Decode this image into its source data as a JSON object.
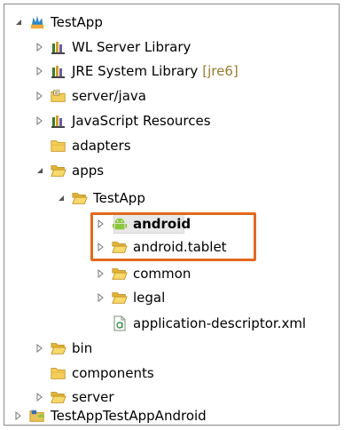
{
  "tree": {
    "root": {
      "label": "TestApp"
    },
    "items": [
      {
        "label": "WL Server Library"
      },
      {
        "label": "JRE System Library",
        "decoration": "[jre6]"
      },
      {
        "label": "server/java"
      },
      {
        "label": "JavaScript Resources"
      },
      {
        "label": "adapters"
      },
      {
        "label": "apps"
      },
      {
        "label": "TestApp"
      },
      {
        "label": "android"
      },
      {
        "label": "android.tablet"
      },
      {
        "label": "common"
      },
      {
        "label": "legal"
      },
      {
        "label": "application-descriptor.xml"
      },
      {
        "label": "bin"
      },
      {
        "label": "components"
      },
      {
        "label": "server"
      },
      {
        "label": "TestAppTestAppAndroid"
      }
    ]
  },
  "colors": {
    "highlight_border": "#e2691f",
    "folder_fill": "#f4cf59",
    "folder_stroke": "#c49322",
    "android_green": "#8dc63f"
  }
}
